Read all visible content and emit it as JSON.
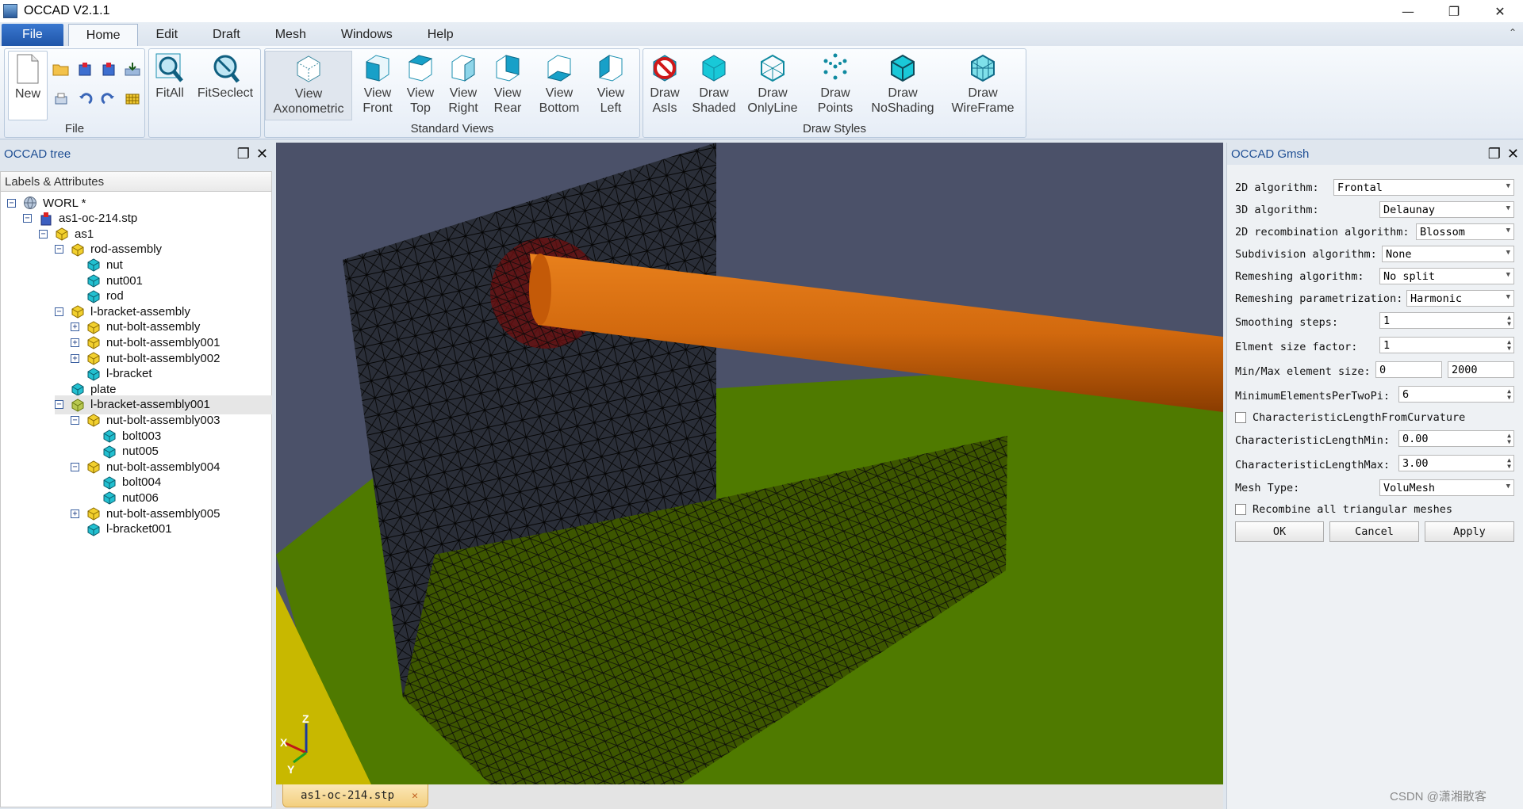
{
  "window": {
    "title": "OCCAD V2.1.1",
    "minimize": "—",
    "restore": "❐",
    "close": "✕"
  },
  "menu": {
    "tabs": [
      "File",
      "Home",
      "Edit",
      "Draft",
      "Mesh",
      "Windows",
      "Help"
    ],
    "collapse": "⌃"
  },
  "ribbon": {
    "file_group": {
      "label": "File",
      "new": "New"
    },
    "fit": {
      "fitall": "FitAll",
      "fitselect": "FitSeclect"
    },
    "standard_views": {
      "label": "Standard Views",
      "axonometric": [
        "View",
        "Axonometric"
      ],
      "front": [
        "View",
        "Front"
      ],
      "top": [
        "View",
        "Top"
      ],
      "right": [
        "View",
        "Right"
      ],
      "rear": [
        "View",
        "Rear"
      ],
      "bottom": [
        "View",
        "Bottom"
      ],
      "left": [
        "View",
        "Left"
      ]
    },
    "draw_styles": {
      "label": "Draw Styles",
      "asis": [
        "Draw",
        "AsIs"
      ],
      "shaded": [
        "Draw",
        "Shaded"
      ],
      "onlyline": [
        "Draw",
        "OnlyLine"
      ],
      "points": [
        "Draw",
        "Points"
      ],
      "noshading": [
        "Draw",
        "NoShading"
      ],
      "wireframe": [
        "Draw",
        "WireFrame"
      ]
    }
  },
  "tree_panel": {
    "title": "OCCAD tree",
    "header": "Labels & Attributes",
    "rows": [
      {
        "label": "WORL *",
        "level": 0,
        "exp": "−",
        "icon": "globe"
      },
      {
        "label": "as1-oc-214.stp",
        "level": 1,
        "exp": "−",
        "icon": "doc"
      },
      {
        "label": "as1",
        "level": 2,
        "exp": "−",
        "icon": "asm"
      },
      {
        "label": "rod-assembly",
        "level": 3,
        "exp": "−",
        "icon": "asm"
      },
      {
        "label": "nut",
        "level": 4,
        "exp": "",
        "icon": "part"
      },
      {
        "label": "nut001",
        "level": 4,
        "exp": "",
        "icon": "part"
      },
      {
        "label": "rod",
        "level": 4,
        "exp": "",
        "icon": "part"
      },
      {
        "label": "l-bracket-assembly",
        "level": 3,
        "exp": "−",
        "icon": "asm"
      },
      {
        "label": "nut-bolt-assembly",
        "level": 4,
        "exp": "+",
        "icon": "asm"
      },
      {
        "label": "nut-bolt-assembly001",
        "level": 4,
        "exp": "+",
        "icon": "asm"
      },
      {
        "label": "nut-bolt-assembly002",
        "level": 4,
        "exp": "+",
        "icon": "asm"
      },
      {
        "label": "l-bracket",
        "level": 4,
        "exp": "",
        "icon": "part"
      },
      {
        "label": "plate",
        "level": 3,
        "exp": "",
        "icon": "part"
      },
      {
        "label": "l-bracket-assembly001",
        "level": 3,
        "exp": "−",
        "icon": "asm-sel",
        "selected": true
      },
      {
        "label": "nut-bolt-assembly003",
        "level": 4,
        "exp": "−",
        "icon": "asm"
      },
      {
        "label": "bolt003",
        "level": 5,
        "exp": "",
        "icon": "part"
      },
      {
        "label": "nut005",
        "level": 5,
        "exp": "",
        "icon": "part"
      },
      {
        "label": "nut-bolt-assembly004",
        "level": 4,
        "exp": "−",
        "icon": "asm"
      },
      {
        "label": "bolt004",
        "level": 5,
        "exp": "",
        "icon": "part"
      },
      {
        "label": "nut006",
        "level": 5,
        "exp": "",
        "icon": "part"
      },
      {
        "label": "nut-bolt-assembly005",
        "level": 4,
        "exp": "+",
        "icon": "asm"
      },
      {
        "label": "l-bracket001",
        "level": 4,
        "exp": "",
        "icon": "part"
      }
    ]
  },
  "viewport": {
    "tab": "as1-oc-214.stp",
    "tab_close": "✕",
    "axes": {
      "z": "Z",
      "x": "X",
      "y": "Y"
    }
  },
  "gmsh_panel": {
    "title": "OCCAD Gmsh",
    "algo2d_label": "2D algorithm:",
    "algo2d": "Frontal",
    "algo3d_label": "3D algorithm:",
    "algo3d": "Delaunay",
    "recomb_label": "2D recombination algorithm:",
    "recomb": "Blossom",
    "subdiv_label": "Subdivision algorithm:",
    "subdiv": "None",
    "remesh_label": "Remeshing algorithm:",
    "remesh": "No split",
    "remeshparam_label": "Remeshing parametrization:",
    "remeshparam": "Harmonic",
    "smooth_label": "Smoothing steps:",
    "smooth": "1",
    "sizefactor_label": "Elment size factor:",
    "sizefactor": "1",
    "minmax_label": "Min/Max element size:",
    "minsize": "0",
    "maxsize": "2000",
    "minperpi_label": "MinimumElementsPerTwoPi:",
    "minperpi": "6",
    "curv_label": "CharacteristicLengthFromCurvature",
    "clmin_label": "CharacteristicLengthMin:",
    "clmin": "0.00",
    "clmax_label": "CharacteristicLengthMax:",
    "clmax": "3.00",
    "meshtype_label": "Mesh Type:",
    "meshtype": "VoluMesh",
    "recomball_label": "Recombine all triangular meshes",
    "ok": "OK",
    "cancel": "Cancel",
    "apply": "Apply"
  },
  "watermark": "CSDN @潇湘散客"
}
